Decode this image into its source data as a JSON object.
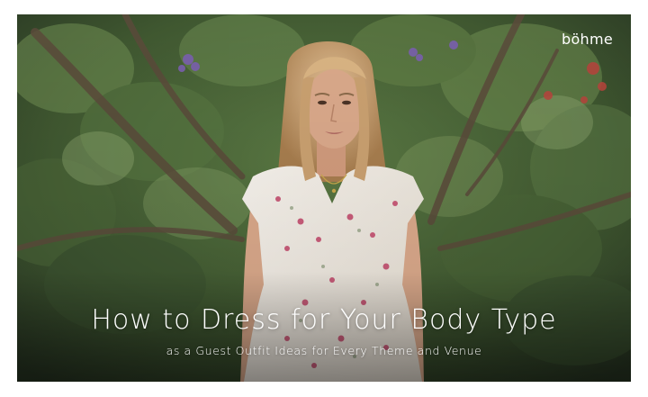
{
  "brand": {
    "logo_text": "böhme"
  },
  "hero": {
    "headline": "How to Dress for Your Body Type",
    "subheadline": "as a Guest Outfit Ideas for Every Theme and Venue"
  },
  "colors": {
    "foliage_dark": "#2c3a26",
    "foliage_mid": "#4d6a3a",
    "foliage_light": "#7f9a5e",
    "dress": "#f1ece4",
    "flower_print": "#c24468",
    "hair": "#c9a070",
    "skin": "#d9a88a",
    "text": "#ffffff"
  }
}
